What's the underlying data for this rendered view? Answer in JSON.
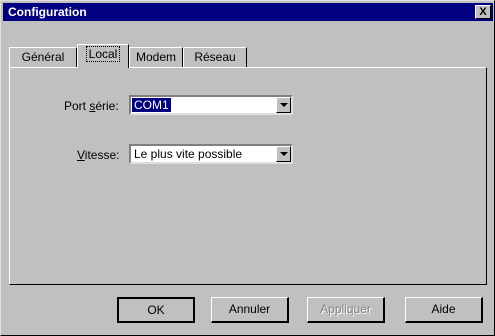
{
  "window": {
    "title": "Configuration",
    "close_label": "X"
  },
  "tabs": [
    {
      "label": "Général"
    },
    {
      "label": "Local"
    },
    {
      "label": "Modem"
    },
    {
      "label": "Réseau"
    }
  ],
  "form": {
    "port": {
      "label_pre": "Port ",
      "label_accel": "s",
      "label_post": "érie:",
      "value": "COM1"
    },
    "speed": {
      "label_pre": "",
      "label_accel": "V",
      "label_post": "itesse:",
      "value": "Le plus vite possible"
    }
  },
  "buttons": {
    "ok": "OK",
    "cancel": "Annuler",
    "apply": "Appliquer",
    "help": "Aide"
  }
}
